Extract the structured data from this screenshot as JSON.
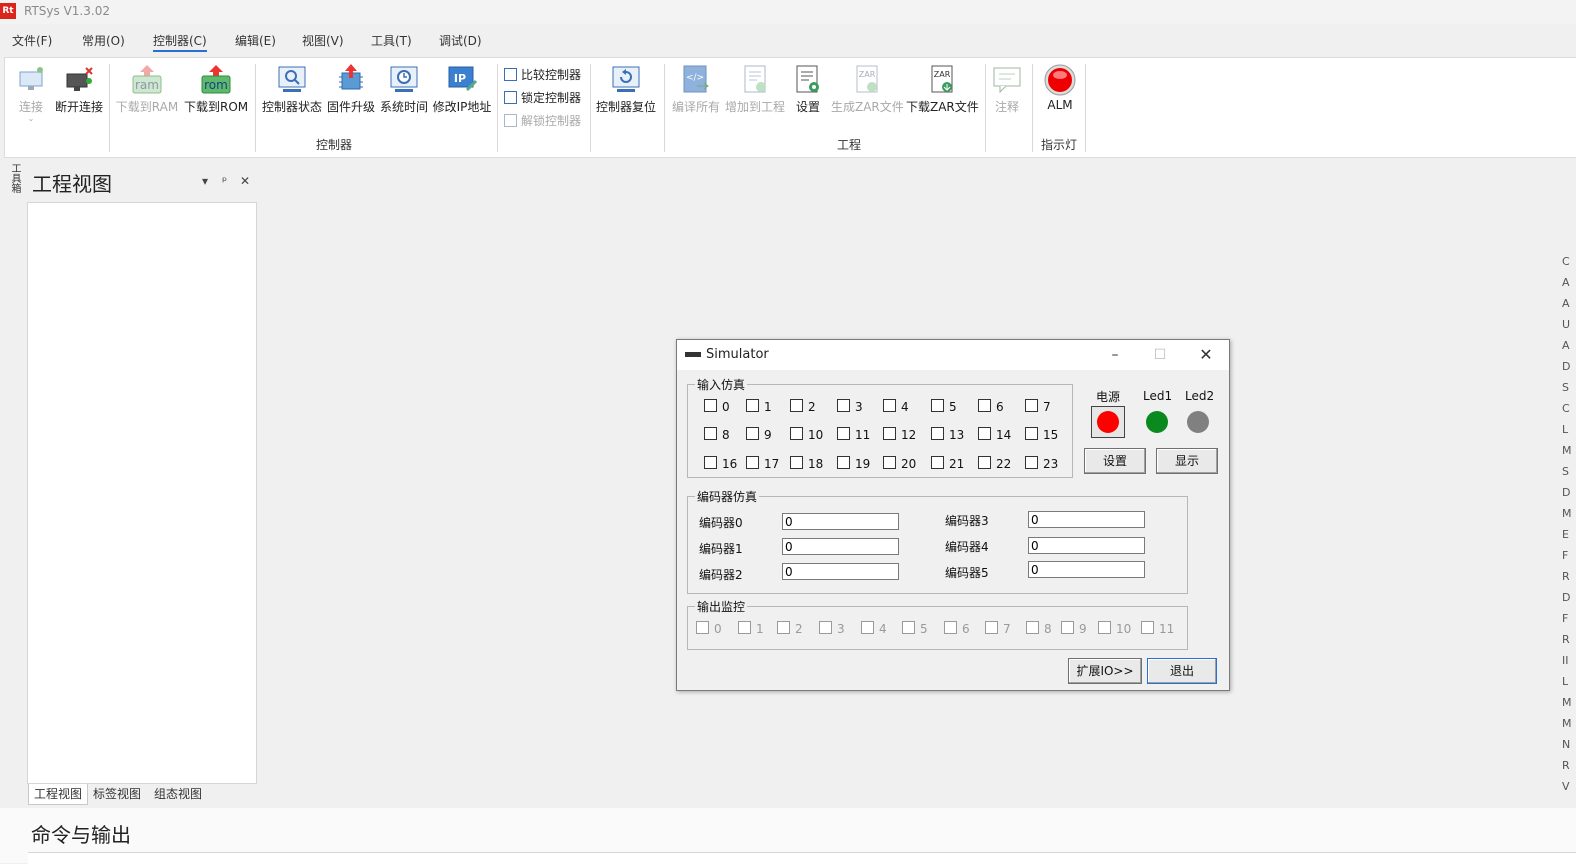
{
  "app": {
    "logo": "Rt",
    "title": "RTSys V1.3.02"
  },
  "menu": [
    "文件(F)",
    "常用(O)",
    "控制器(C)",
    "编辑(E)",
    "视图(V)",
    "工具(T)",
    "调试(D)"
  ],
  "ribbon": {
    "connect": "连接",
    "disconnect": "断开连接",
    "download_ram": "下载到RAM",
    "download_rom": "下载到ROM",
    "ram_text": "ram",
    "rom_text": "rom",
    "controller_status": "控制器状态",
    "firmware_upgrade": "固件升级",
    "system_time": "系统时间",
    "modify_ip": "修改IP地址",
    "compare_controller": "比较控制器",
    "lock_controller": "锁定控制器",
    "unlock_controller": "解锁控制器",
    "controller_reset": "控制器复位",
    "group_controller": "控制器",
    "compile_all": "编译所有",
    "add_to_project": "增加到工程",
    "settings": "设置",
    "generate_zar": "生成ZAR文件",
    "download_zar": "下载ZAR文件",
    "zar_text": "ZAR",
    "group_project": "工程",
    "comment": "注释",
    "alm": "ALM",
    "group_indicator": "指示灯"
  },
  "left_strip": "工具箱",
  "project_pane": {
    "title": "工程视图",
    "tabs": [
      "工程视图",
      "标签视图",
      "组态视图"
    ]
  },
  "output_pane": {
    "title": "命令与输出"
  },
  "right_panel_chars": [
    "C",
    "A",
    "A",
    "U",
    "A",
    "D",
    "S",
    "C",
    "L",
    "M",
    "S",
    "D",
    "M",
    "E",
    "F",
    "R",
    "D",
    "F",
    "R",
    "II",
    "L",
    "M",
    "M",
    "N",
    "R",
    "V"
  ],
  "simulator": {
    "title": "Simulator",
    "input_group": "输入仿真",
    "inputs": [
      "0",
      "1",
      "2",
      "3",
      "4",
      "5",
      "6",
      "7",
      "8",
      "9",
      "10",
      "11",
      "12",
      "13",
      "14",
      "15",
      "16",
      "17",
      "18",
      "19",
      "20",
      "21",
      "22",
      "23"
    ],
    "power_label": "电源",
    "led1_label": "Led1",
    "led2_label": "Led2",
    "set_button": "设置",
    "show_button": "显示",
    "encoder_group": "编码器仿真",
    "encoders": [
      {
        "label": "编码器0",
        "value": "0"
      },
      {
        "label": "编码器1",
        "value": "0"
      },
      {
        "label": "编码器2",
        "value": "0"
      },
      {
        "label": "编码器3",
        "value": "0"
      },
      {
        "label": "编码器4",
        "value": "0"
      },
      {
        "label": "编码器5",
        "value": "0"
      }
    ],
    "output_group": "输出监控",
    "outputs": [
      "0",
      "1",
      "2",
      "3",
      "4",
      "5",
      "6",
      "7",
      "8",
      "9",
      "10",
      "11"
    ],
    "expand_io_button": "扩展IO>>",
    "exit_button": "退出",
    "colors": {
      "power": "#ff0000",
      "led1": "#0a8a1e",
      "led2": "#808080"
    }
  }
}
